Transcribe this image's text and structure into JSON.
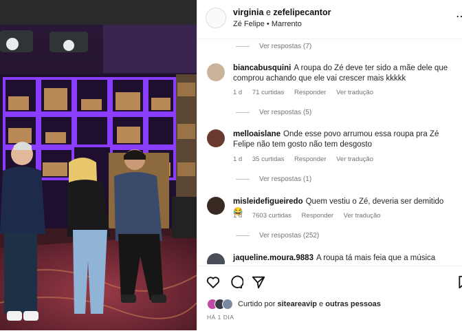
{
  "header": {
    "user1": "virginia",
    "joiner": "e",
    "user2": "zefelipecantor",
    "subtitle": "Zé Felipe • Marrento"
  },
  "comments": [
    {
      "user": "biancabusquini",
      "text": "A roupa do Zé deve ter sido a mãe dele que comprou achando que ele vai crescer mais kkkkk",
      "time": "1 d",
      "likes": "71 curtidas",
      "reply": "Responder",
      "translate": "Ver tradução",
      "replies": "Ver respostas (5)",
      "avatar_color": "#c9b39a"
    },
    {
      "user": "melloaislane",
      "text": "Onde esse povo arrumou essa roupa pra Zé Felipe não tem gosto não tem desgosto",
      "time": "1 d",
      "likes": "35 curtidas",
      "reply": "Responder",
      "translate": "Ver tradução",
      "replies": "Ver respostas (1)",
      "avatar_color": "#6b3a2e"
    },
    {
      "user": "misleidefigueiredo",
      "text": "Quem vestiu o Zé, deveria ser demitido 😂",
      "time": "1 d",
      "likes": "7603 curtidas",
      "reply": "Responder",
      "translate": "Ver tradução",
      "replies": "Ver respostas (252)",
      "avatar_color": "#3a2a24"
    },
    {
      "user": "jaqueline.moura.9883",
      "text": "A roupa tá mais feia que a música",
      "avatar_color": "#4a4e58"
    }
  ],
  "top_replies": "Ver respostas (7)",
  "footer": {
    "liked_prefix": "Curtido por",
    "liked_user": "siteareavip",
    "liked_joiner": "e",
    "liked_others": "outras pessoas",
    "date": "HÁ 1 DIA"
  },
  "icons": [
    "heart-icon",
    "comment-icon",
    "share-icon",
    "bookmark-icon",
    "more-icon"
  ],
  "colors": {
    "meta_text": "#737373",
    "text": "#262626",
    "accent_purple": "#7b2cff"
  }
}
